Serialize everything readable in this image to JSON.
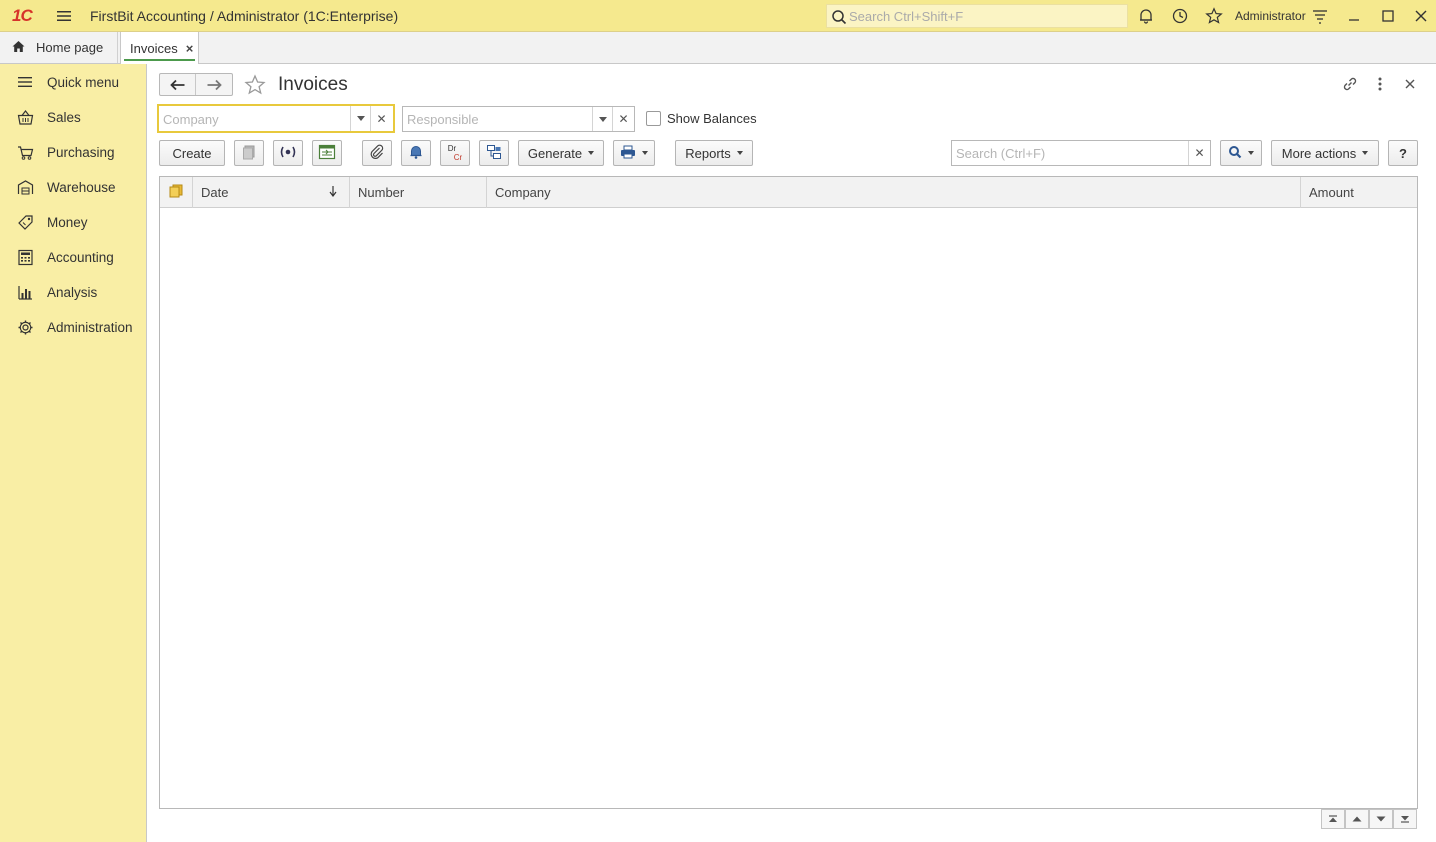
{
  "titlebar": {
    "logo_text": "1С",
    "title": "FirstBit Accounting / Administrator  (1C:Enterprise)",
    "search_placeholder": "Search Ctrl+Shift+F",
    "user": "Administrator"
  },
  "tabs": {
    "home_label": "Home page",
    "active_label": "Invoices",
    "close_glyph": "×"
  },
  "sidebar": {
    "items": [
      {
        "label": "Quick menu",
        "icon": "menu-icon"
      },
      {
        "label": "Sales",
        "icon": "basket-icon"
      },
      {
        "label": "Purchasing",
        "icon": "cart-icon"
      },
      {
        "label": "Warehouse",
        "icon": "warehouse-icon"
      },
      {
        "label": "Money",
        "icon": "money-icon"
      },
      {
        "label": "Accounting",
        "icon": "calculator-icon"
      },
      {
        "label": "Analysis",
        "icon": "chart-icon"
      },
      {
        "label": "Administration",
        "icon": "gear-icon"
      }
    ]
  },
  "form": {
    "title": "Invoices",
    "company_placeholder": "Company",
    "responsible_placeholder": "Responsible",
    "show_balances_label": "Show Balances",
    "toolbar": {
      "create": "Create",
      "generate": "Generate",
      "reports": "Reports",
      "more_actions": "More actions",
      "help": "?",
      "dr": "Dr",
      "cr": "Cr"
    },
    "search_placeholder": "Search (Ctrl+F)",
    "table": {
      "columns": [
        "Date",
        "Number",
        "Company",
        "Amount"
      ],
      "rows": []
    }
  },
  "colors": {
    "titlebar": "#f5e98e",
    "sidebar": "#f9eea5",
    "accent_green": "#4c9a4c",
    "focus_yellow": "#e8c93c",
    "logo_red": "#d6332a"
  }
}
